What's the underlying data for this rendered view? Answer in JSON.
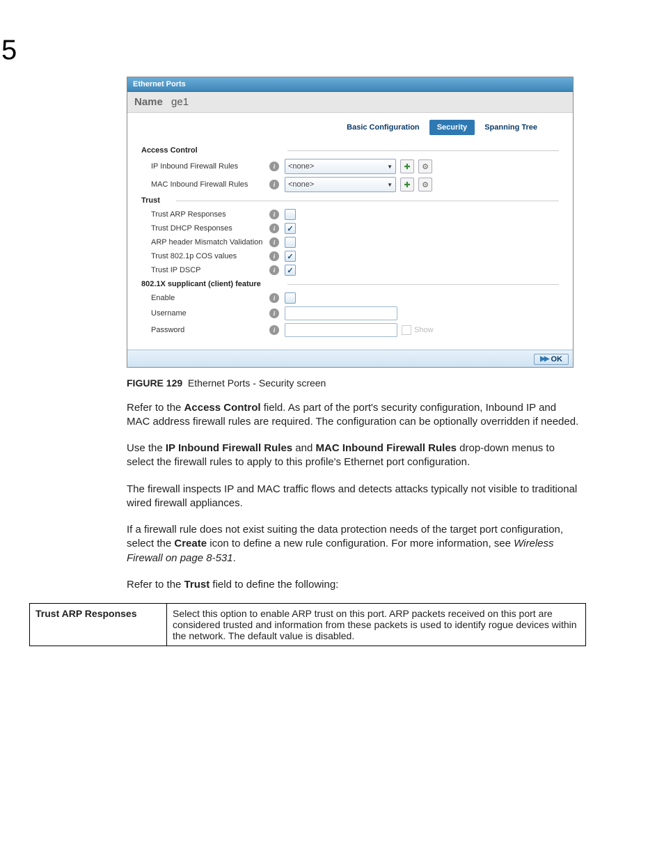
{
  "chapter_number": "5",
  "panel": {
    "title": "Ethernet Ports",
    "name_label": "Name",
    "name_value": "ge1",
    "tabs": {
      "basic": "Basic Configuration",
      "security": "Security",
      "spanning": "Spanning Tree"
    },
    "access_control": {
      "section": "Access Control",
      "ip_label": "IP Inbound Firewall Rules",
      "ip_value": "<none>",
      "mac_label": "MAC Inbound Firewall Rules",
      "mac_value": "<none>"
    },
    "trust": {
      "section": "Trust",
      "arp": "Trust ARP Responses",
      "dhcp": "Trust DHCP Responses",
      "mismatch": "ARP header Mismatch Validation",
      "cos": "Trust 802.1p COS values",
      "dscp": "Trust IP DSCP"
    },
    "supplicant": {
      "section": "802.1X supplicant (client) feature",
      "enable": "Enable",
      "username": "Username",
      "password": "Password",
      "show": "Show"
    },
    "ok": "OK"
  },
  "figure": {
    "label": "FIGURE 129",
    "caption": "Ethernet Ports - Security screen"
  },
  "body": {
    "p1a": "Refer to the ",
    "p1b": "Access Control",
    "p1c": " field. As part of the port's security configuration, Inbound IP and MAC address firewall rules are required. The configuration can be optionally overridden if needed.",
    "p2a": "Use the ",
    "p2b": "IP Inbound Firewall Rules",
    "p2c": " and ",
    "p2d": "MAC Inbound Firewall Rules",
    "p2e": " drop-down menus to select the firewall rules to apply to this profile's Ethernet port configuration.",
    "p3": "The firewall inspects IP and MAC traffic flows and detects attacks typically not visible to traditional wired firewall appliances.",
    "p4a": "If a firewall rule does not exist suiting the data protection needs of the target port configuration, select the ",
    "p4b": "Create",
    "p4c": " icon to define a new rule configuration. For more information, see ",
    "p4d": "Wireless Firewall on page 8-531",
    "p4e": ".",
    "p5a": "Refer to the ",
    "p5b": "Trust",
    "p5c": " field to define the following:"
  },
  "table": {
    "row1_key": "Trust ARP Responses",
    "row1_val": "Select this option to enable ARP trust on this port. ARP packets received on this port are considered trusted and information from these packets is used to identify rogue devices within the network. The default value is disabled."
  }
}
